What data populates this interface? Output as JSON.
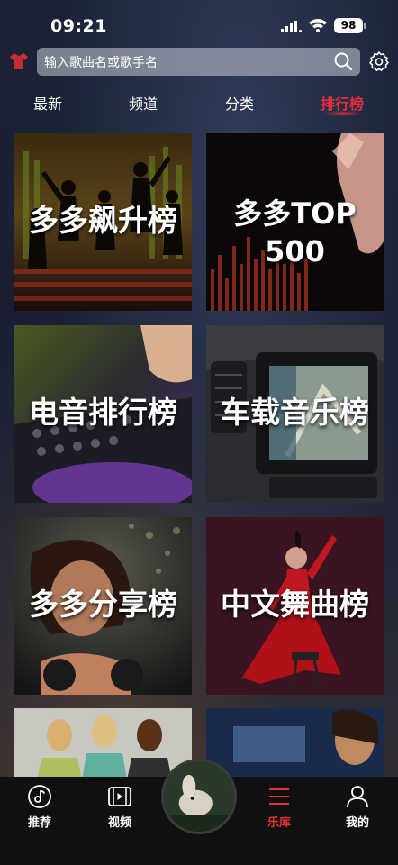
{
  "status_bar": {
    "time": "09:21",
    "battery": "98"
  },
  "search": {
    "placeholder": "输入歌曲名或歌手名"
  },
  "tabs": [
    {
      "label": "最新",
      "active": false
    },
    {
      "label": "频道",
      "active": false
    },
    {
      "label": "分类",
      "active": false
    },
    {
      "label": "排行榜",
      "active": true
    }
  ],
  "charts": [
    {
      "label": "多多飙升榜"
    },
    {
      "label": "多多TOP\n500"
    },
    {
      "label": "电音排行榜"
    },
    {
      "label": "车载音乐榜"
    },
    {
      "label": "多多分享榜"
    },
    {
      "label": "中文舞曲榜"
    }
  ],
  "bottom_nav": [
    {
      "label": "推荐",
      "icon": "music-disc-icon",
      "active": false
    },
    {
      "label": "视频",
      "icon": "video-icon",
      "active": false
    },
    {
      "label": "乐库",
      "icon": "menu-lines-icon",
      "active": true
    },
    {
      "label": "我的",
      "icon": "person-icon",
      "active": false
    }
  ],
  "colors": {
    "accent": "#e8303a",
    "nav_bg": "#101010"
  }
}
